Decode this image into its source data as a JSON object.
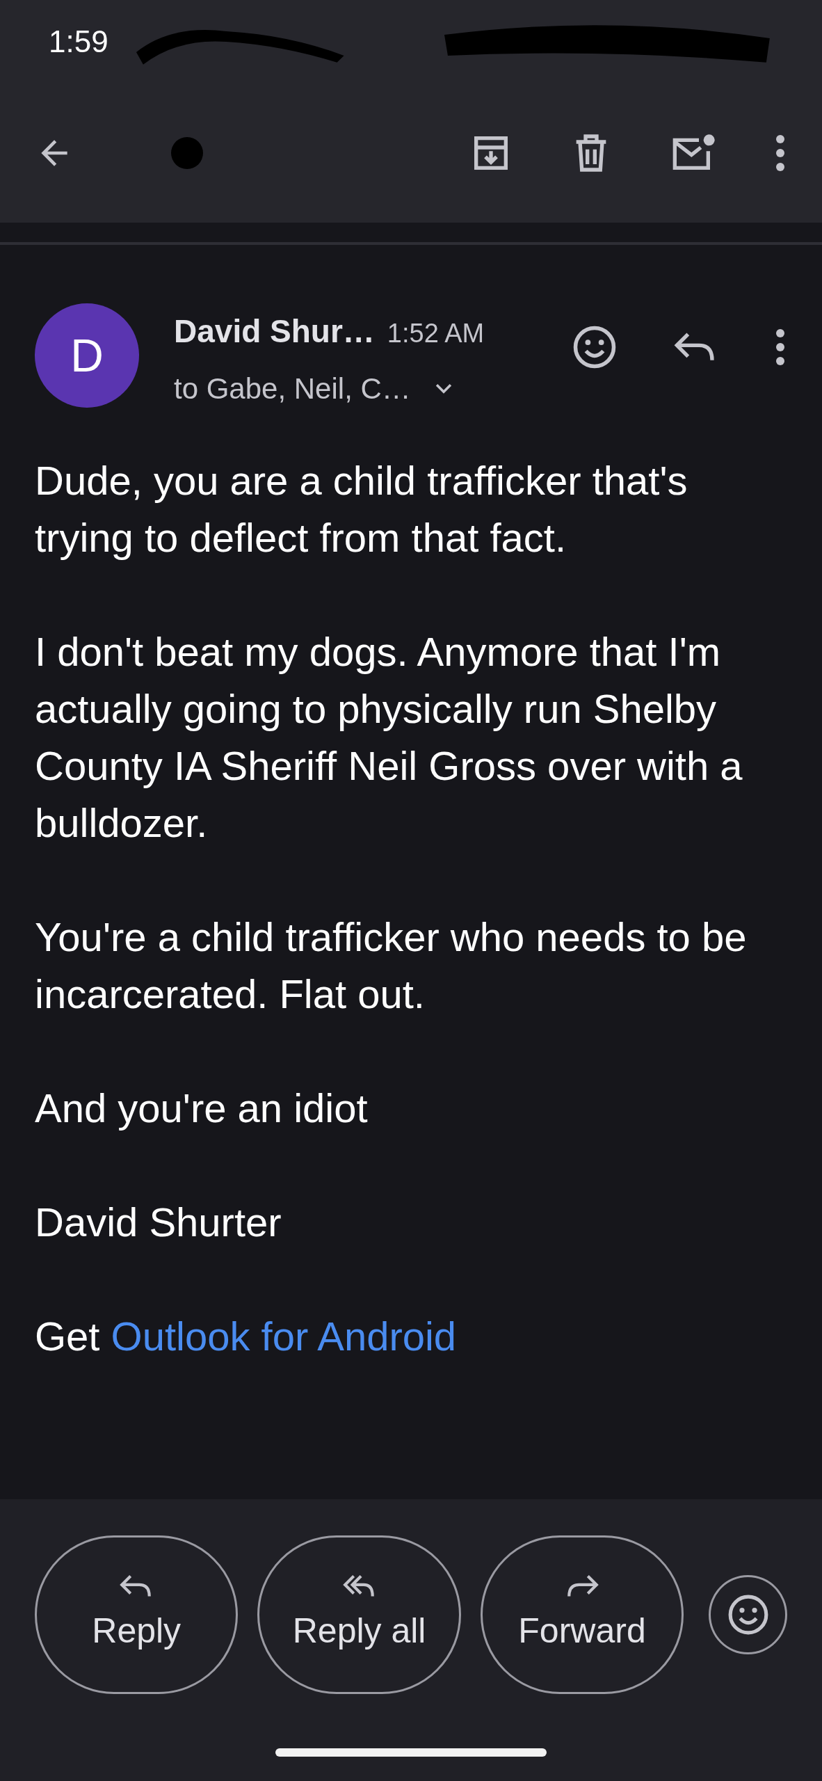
{
  "status_bar": {
    "time": "1:59"
  },
  "message": {
    "avatar_letter": "D",
    "sender": "David Shur…",
    "time": "1:52 AM",
    "recipients": "to Gabe, Neil, C…",
    "paragraphs": [
      {
        "text": "Dude, you are a child trafficker that's trying to deflect from that fact."
      },
      {
        "text": "I don't beat my dogs. Anymore that I'm actually going to physically run Shelby County IA Sheriff Neil Gross over with a bulldozer."
      },
      {
        "text": "You're a child trafficker who needs to be incarcerated. Flat out."
      },
      {
        "text": "And you're an idiot"
      },
      {
        "text": "David Shurter"
      }
    ],
    "signature": {
      "prefix": "Get",
      "link": "Outlook for Android"
    }
  },
  "actions": [
    {
      "kind": "reply",
      "label": "Reply"
    },
    {
      "kind": "reply_all",
      "label": "Reply all"
    },
    {
      "kind": "forward",
      "label": "Forward"
    }
  ]
}
